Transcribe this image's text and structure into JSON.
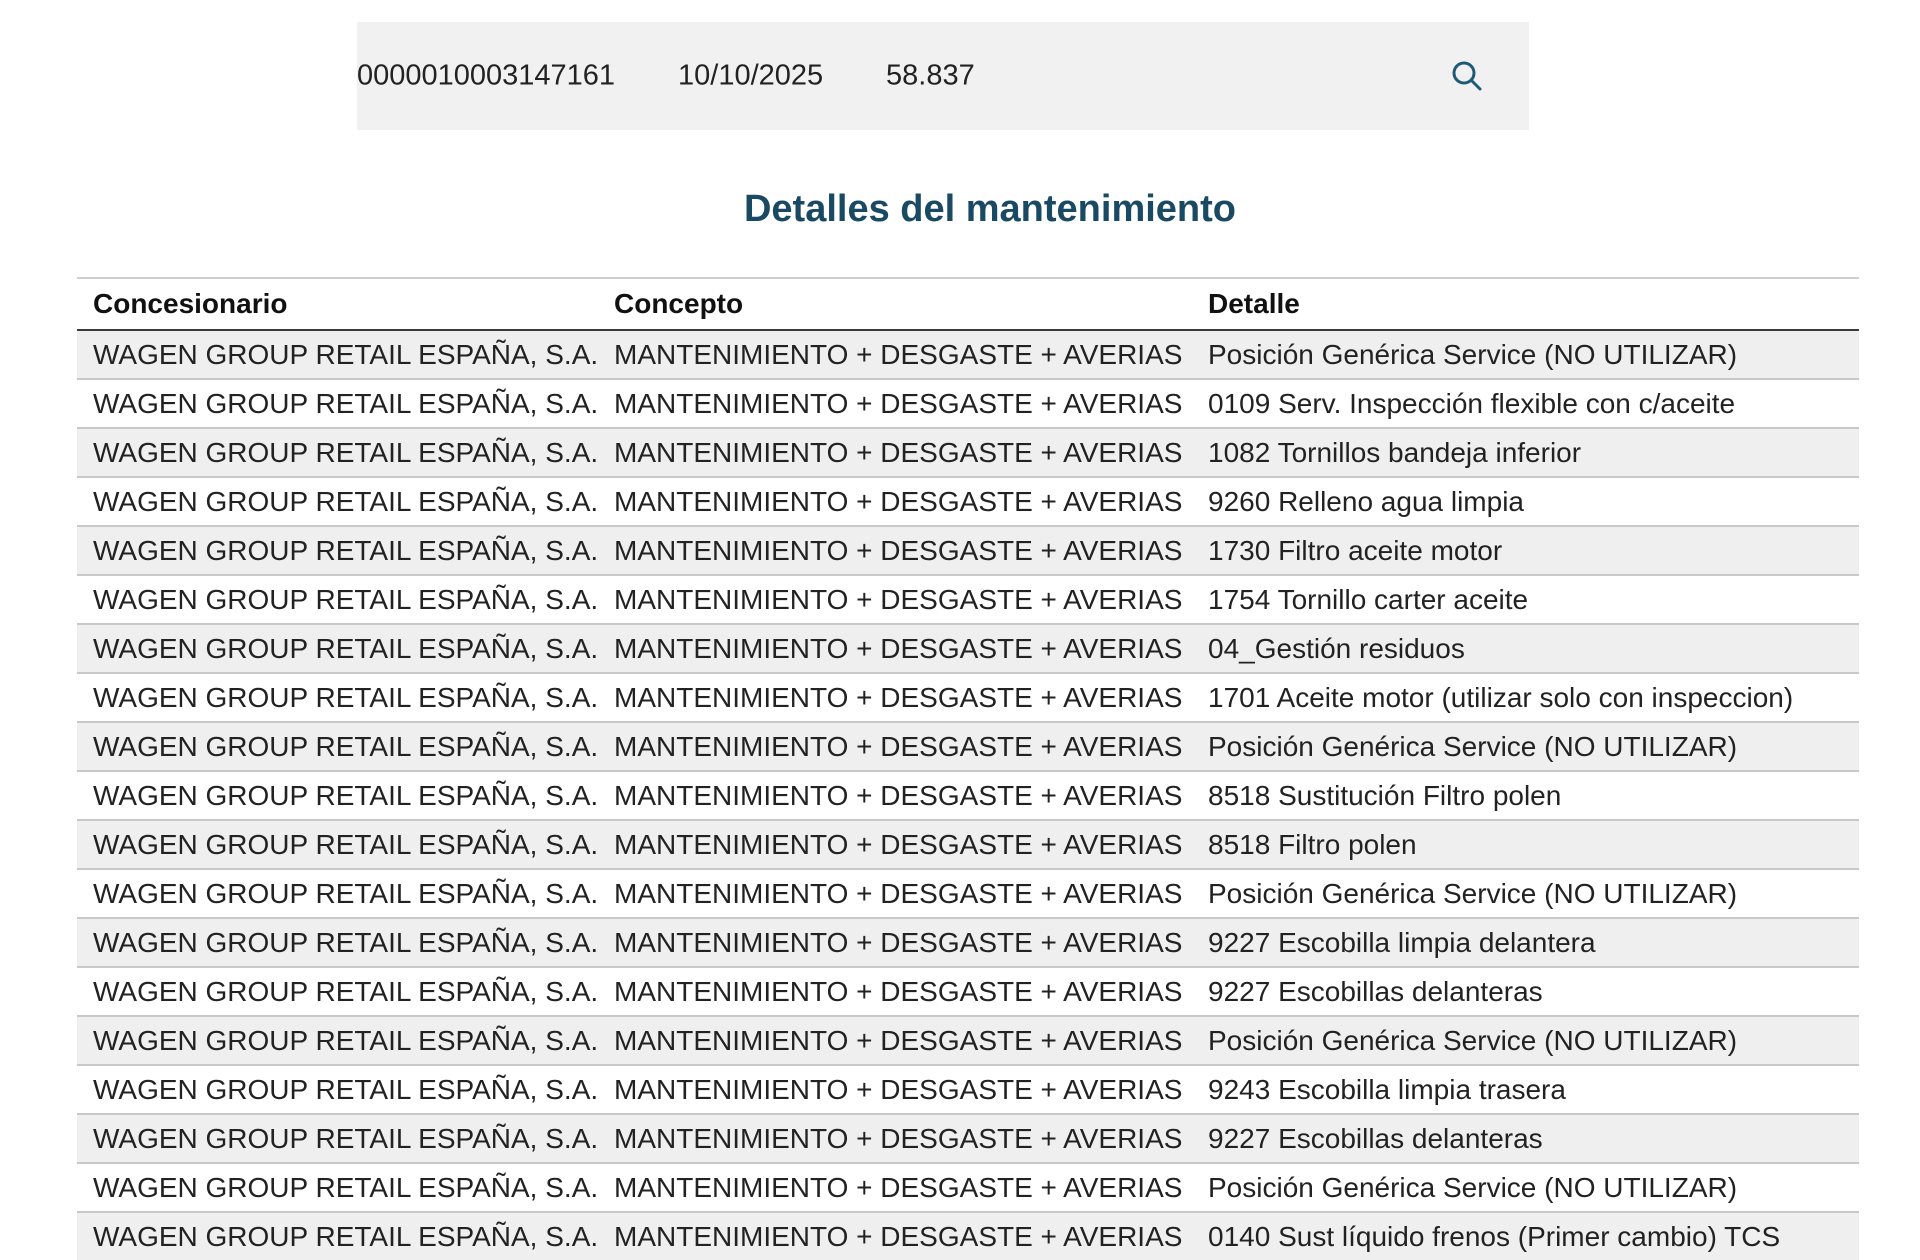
{
  "summary": {
    "id": "0000010003147161",
    "date": "10/10/2025",
    "km": "58.837",
    "search_icon": "search-icon"
  },
  "title": "Detalles del mantenimiento",
  "table": {
    "headers": [
      "Concesionario",
      "Concepto",
      "Detalle"
    ],
    "rows": [
      [
        "WAGEN GROUP RETAIL ESPAÑA, S.A.",
        "MANTENIMIENTO + DESGASTE + AVERIAS",
        "Posición Genérica Service (NO UTILIZAR)"
      ],
      [
        "WAGEN GROUP RETAIL ESPAÑA, S.A.",
        "MANTENIMIENTO + DESGASTE + AVERIAS",
        "0109 Serv. Inspección flexible con c/aceite"
      ],
      [
        "WAGEN GROUP RETAIL ESPAÑA, S.A.",
        "MANTENIMIENTO + DESGASTE + AVERIAS",
        "1082 Tornillos bandeja inferior"
      ],
      [
        "WAGEN GROUP RETAIL ESPAÑA, S.A.",
        "MANTENIMIENTO + DESGASTE + AVERIAS",
        "9260 Relleno agua limpia"
      ],
      [
        "WAGEN GROUP RETAIL ESPAÑA, S.A.",
        "MANTENIMIENTO + DESGASTE + AVERIAS",
        "1730 Filtro aceite motor"
      ],
      [
        "WAGEN GROUP RETAIL ESPAÑA, S.A.",
        "MANTENIMIENTO + DESGASTE + AVERIAS",
        "1754 Tornillo carter aceite"
      ],
      [
        "WAGEN GROUP RETAIL ESPAÑA, S.A.",
        "MANTENIMIENTO + DESGASTE + AVERIAS",
        "04_Gestión residuos"
      ],
      [
        "WAGEN GROUP RETAIL ESPAÑA, S.A.",
        "MANTENIMIENTO + DESGASTE + AVERIAS",
        "1701 Aceite motor (utilizar solo con inspeccion)"
      ],
      [
        "WAGEN GROUP RETAIL ESPAÑA, S.A.",
        "MANTENIMIENTO + DESGASTE + AVERIAS",
        "Posición Genérica Service (NO UTILIZAR)"
      ],
      [
        "WAGEN GROUP RETAIL ESPAÑA, S.A.",
        "MANTENIMIENTO + DESGASTE + AVERIAS",
        "8518 Sustitución Filtro polen"
      ],
      [
        "WAGEN GROUP RETAIL ESPAÑA, S.A.",
        "MANTENIMIENTO + DESGASTE + AVERIAS",
        "8518 Filtro polen"
      ],
      [
        "WAGEN GROUP RETAIL ESPAÑA, S.A.",
        "MANTENIMIENTO + DESGASTE + AVERIAS",
        "Posición Genérica Service (NO UTILIZAR)"
      ],
      [
        "WAGEN GROUP RETAIL ESPAÑA, S.A.",
        "MANTENIMIENTO + DESGASTE + AVERIAS",
        "9227 Escobilla limpia delantera"
      ],
      [
        "WAGEN GROUP RETAIL ESPAÑA, S.A.",
        "MANTENIMIENTO + DESGASTE + AVERIAS",
        "9227 Escobillas delanteras"
      ],
      [
        "WAGEN GROUP RETAIL ESPAÑA, S.A.",
        "MANTENIMIENTO + DESGASTE + AVERIAS",
        "Posición Genérica Service (NO UTILIZAR)"
      ],
      [
        "WAGEN GROUP RETAIL ESPAÑA, S.A.",
        "MANTENIMIENTO + DESGASTE + AVERIAS",
        "9243 Escobilla limpia trasera"
      ],
      [
        "WAGEN GROUP RETAIL ESPAÑA, S.A.",
        "MANTENIMIENTO + DESGASTE + AVERIAS",
        "9227 Escobillas delanteras"
      ],
      [
        "WAGEN GROUP RETAIL ESPAÑA, S.A.",
        "MANTENIMIENTO + DESGASTE + AVERIAS",
        "Posición Genérica Service (NO UTILIZAR)"
      ],
      [
        "WAGEN GROUP RETAIL ESPAÑA, S.A.",
        "MANTENIMIENTO + DESGASTE + AVERIAS",
        "0140 Sust líquido frenos (Primer cambio) TCS"
      ]
    ]
  }
}
